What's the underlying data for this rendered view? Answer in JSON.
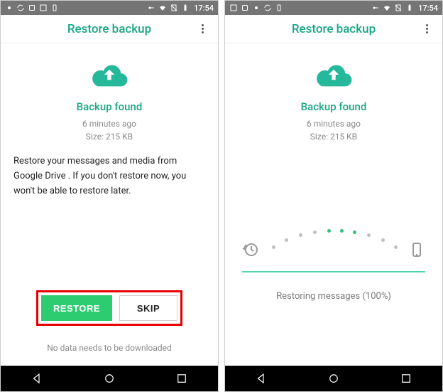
{
  "left": {
    "status": {
      "time": "17:54"
    },
    "title": "Restore backup",
    "found": "Backup found",
    "ago": "6 minutes ago",
    "size": "Size: 215 KB",
    "explain": "Restore your messages and media from Google Drive . If you don't restore now, you won't be able to restore later.",
    "restore_btn": "RESTORE",
    "skip_btn": "SKIP",
    "bottom_note": "No data needs to be downloaded"
  },
  "right": {
    "status": {
      "time": "17:54"
    },
    "title": "Restore backup",
    "found": "Backup found",
    "ago": "6 minutes ago",
    "size": "Size: 215 KB",
    "progress_text": "Restoring messages (100%)"
  }
}
